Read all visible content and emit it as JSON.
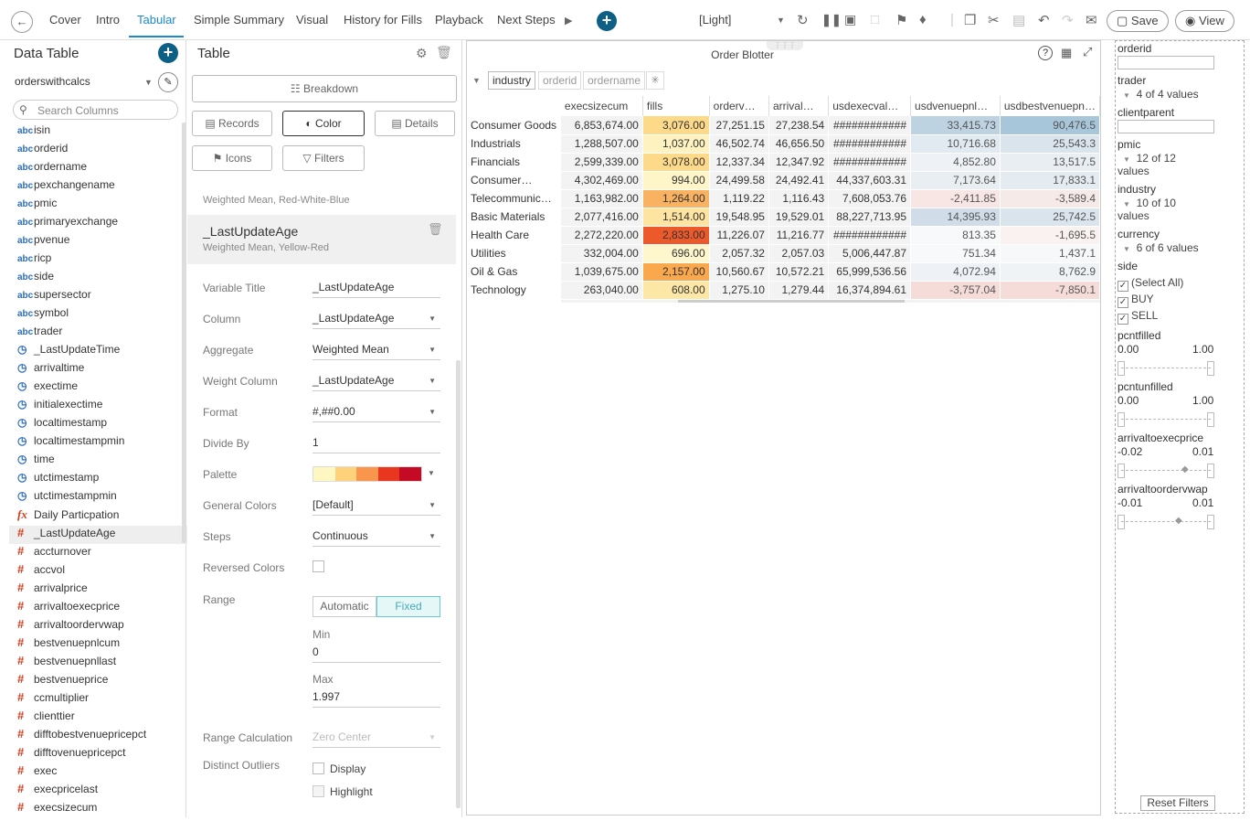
{
  "nav": {
    "tabs": [
      "Cover",
      "Intro",
      "Tabular",
      "Simple Summary",
      "Visual",
      "History for Fills",
      "Playback",
      "Next Steps"
    ],
    "theme": "[Light]",
    "save_label": "Save",
    "view_label": "View"
  },
  "data_table": {
    "title": "Data Table",
    "source": "orderswithcalcs",
    "search_placeholder": "Search Columns",
    "fields": [
      {
        "type": "abc",
        "name": "isin"
      },
      {
        "type": "abc",
        "name": "orderid"
      },
      {
        "type": "abc",
        "name": "ordername"
      },
      {
        "type": "abc",
        "name": "pexchangename"
      },
      {
        "type": "abc",
        "name": "pmic"
      },
      {
        "type": "abc",
        "name": "primaryexchange"
      },
      {
        "type": "abc",
        "name": "pvenue"
      },
      {
        "type": "abc",
        "name": "ricp"
      },
      {
        "type": "abc",
        "name": "side"
      },
      {
        "type": "abc",
        "name": "supersector"
      },
      {
        "type": "abc",
        "name": "symbol"
      },
      {
        "type": "abc",
        "name": "trader"
      },
      {
        "type": "time",
        "name": "_LastUpdateTime"
      },
      {
        "type": "time",
        "name": "arrivaltime"
      },
      {
        "type": "time",
        "name": "exectime"
      },
      {
        "type": "time",
        "name": "initialexectime"
      },
      {
        "type": "time",
        "name": "localtimestamp"
      },
      {
        "type": "time",
        "name": "localtimestampmin"
      },
      {
        "type": "time",
        "name": "time"
      },
      {
        "type": "time",
        "name": "utctimestamp"
      },
      {
        "type": "time",
        "name": "utctimestampmin"
      },
      {
        "type": "fx",
        "name": "Daily Particpation"
      },
      {
        "type": "num",
        "name": "_LastUpdateAge"
      },
      {
        "type": "num",
        "name": "accturnover"
      },
      {
        "type": "num",
        "name": "accvol"
      },
      {
        "type": "num",
        "name": "arrivalprice"
      },
      {
        "type": "num",
        "name": "arrivaltoexecprice"
      },
      {
        "type": "num",
        "name": "arrivaltoordervwap"
      },
      {
        "type": "num",
        "name": "bestvenuepnlcum"
      },
      {
        "type": "num",
        "name": "bestvenuepnllast"
      },
      {
        "type": "num",
        "name": "bestvenueprice"
      },
      {
        "type": "num",
        "name": "ccmultiplier"
      },
      {
        "type": "num",
        "name": "clienttier"
      },
      {
        "type": "num",
        "name": "difftobestvenuepricepct"
      },
      {
        "type": "num",
        "name": "difftovenuepricepct"
      },
      {
        "type": "num",
        "name": "exec"
      },
      {
        "type": "num",
        "name": "execpricelast"
      },
      {
        "type": "num",
        "name": "execsizecum"
      }
    ]
  },
  "table_settings": {
    "title": "Table",
    "breakdown": "Breakdown",
    "buttons": [
      "Records",
      "Color",
      "Details",
      "Icons",
      "Filters"
    ],
    "prev_sub": "Weighted Mean, Red-White-Blue",
    "item_title": "_LastUpdateAge",
    "item_sub": "Weighted Mean, Yellow-Red",
    "props": {
      "variable_title": {
        "label": "Variable Title",
        "value": "_LastUpdateAge"
      },
      "column": {
        "label": "Column",
        "value": "_LastUpdateAge"
      },
      "aggregate": {
        "label": "Aggregate",
        "value": "Weighted Mean"
      },
      "weight_column": {
        "label": "Weight Column",
        "value": "_LastUpdateAge"
      },
      "format": {
        "label": "Format",
        "value": "#,##0.00"
      },
      "divide_by": {
        "label": "Divide By",
        "value": "1"
      },
      "palette": {
        "label": "Palette"
      },
      "general_colors": {
        "label": "General Colors",
        "value": "[Default]"
      },
      "steps": {
        "label": "Steps",
        "value": "Continuous"
      },
      "reversed_colors": {
        "label": "Reversed Colors"
      },
      "range": {
        "label": "Range",
        "automatic": "Automatic",
        "fixed": "Fixed"
      },
      "min": {
        "label": "Min",
        "value": "0"
      },
      "max": {
        "label": "Max",
        "value": "1.997"
      },
      "range_calculation": {
        "label": "Range Calculation",
        "value": "Zero Center"
      },
      "distinct_outliers": {
        "label": "Distinct Outliers",
        "display": "Display",
        "highlight": "Highlight"
      }
    },
    "palette_colors": [
      "#fff7c2",
      "#fdd27a",
      "#f9964e",
      "#e8361f",
      "#c40a25"
    ]
  },
  "blotter": {
    "title": "Order Blotter",
    "breakdown_chips": [
      "industry",
      "orderid",
      "ordername"
    ],
    "columns": [
      "execsizecum",
      "fills",
      "orderv…",
      "arrival…",
      "usdexecval…",
      "usdvenuepnl…",
      "usdbestvenuepn…"
    ],
    "rows": [
      {
        "name": "Consumer Goods",
        "vals": [
          "6,853,674.00",
          "3,076.00",
          "27,251.15",
          "27,238.54",
          "############",
          "33,415.73",
          "90,476.5"
        ],
        "fc": "#fdd98a",
        "c5": "#bed3e1",
        "c6": "#a8c6da"
      },
      {
        "name": "Industrials",
        "vals": [
          "1,288,507.00",
          "1,037.00",
          "46,502.74",
          "46,656.50",
          "############",
          "10,716.68",
          "25,543.3"
        ],
        "fc": "#fef3c0",
        "c5": "#e2eaf1",
        "c6": "#dae4ed"
      },
      {
        "name": "Financials",
        "vals": [
          "2,599,339.00",
          "3,078.00",
          "12,337.34",
          "12,347.92",
          "############",
          "4,852.80",
          "13,517.5"
        ],
        "fc": "#fdd98a",
        "c5": "#eef2f6",
        "c6": "#e9eef3"
      },
      {
        "name": "Consumer…",
        "vals": [
          "4,302,469.00",
          "994.00",
          "24,499.58",
          "24,492.41",
          "44,337,603.31",
          "7,173.64",
          "17,833.1"
        ],
        "fc": "#fef5c8",
        "c5": "#e9eef3",
        "c6": "#e4ebf1"
      },
      {
        "name": "Telecommunic…",
        "vals": [
          "1,163,982.00",
          "1,264.00",
          "1,119.22",
          "1,116.43",
          "7,608,053.76",
          "-2,411.85",
          "-3,589.4"
        ],
        "fc": "#f8b261",
        "c5": "#f8e6e4",
        "c6": "#f6eae8"
      },
      {
        "name": "Basic Materials",
        "vals": [
          "2,077,416.00",
          "1,514.00",
          "19,548.95",
          "19,529.01",
          "88,227,713.95",
          "14,395.93",
          "25,742.5"
        ],
        "fc": "#fde4a0",
        "c5": "#d0dde8",
        "c6": "#dae4ed"
      },
      {
        "name": "Health Care",
        "vals": [
          "2,272,220.00",
          "2,833.00",
          "11,226.07",
          "11,216.77",
          "############",
          "813.35",
          "-1,695.5"
        ],
        "fc": "#ec5a2c",
        "c5": "#f8f9fb",
        "c6": "#faf2f1"
      },
      {
        "name": "Utilities",
        "vals": [
          "332,004.00",
          "696.00",
          "2,057.32",
          "2,057.03",
          "5,006,447.87",
          "751.34",
          "1,437.1"
        ],
        "fc": "#fef6cc",
        "c5": "#f8f9fb",
        "c6": "#f7f8fa"
      },
      {
        "name": "Oil & Gas",
        "vals": [
          "1,039,675.00",
          "2,157.00",
          "10,560.67",
          "10,572.21",
          "65,999,536.56",
          "4,072.94",
          "8,762.9"
        ],
        "fc": "#f9a84e",
        "c5": "#eef2f6",
        "c6": "#f0f3f6"
      },
      {
        "name": "Technology",
        "vals": [
          "263,040.00",
          "608.00",
          "1,275.10",
          "1,279.44",
          "16,374,894.61",
          "-3,757.04",
          "-7,850.1"
        ],
        "fc": "#fde7a6",
        "c5": "#f6dcd9",
        "c6": "#f6dcd9"
      }
    ]
  },
  "filters": {
    "orderid": "orderid",
    "trader": "trader",
    "trader_sub": "4 of 4 values",
    "clientparent": "clientparent",
    "pmic": "pmic",
    "pmic_sub": "12 of 12",
    "pmic_sub2": "values",
    "industry": "industry",
    "industry_sub": "10 of 10",
    "industry_sub2": "values",
    "currency": "currency",
    "currency_sub": "6 of 6 values",
    "side": "side",
    "side_opts": [
      "(Select All)",
      "BUY",
      "SELL"
    ],
    "pcntfilled": {
      "label": "pcntfilled",
      "min": "0.00",
      "max": "1.00"
    },
    "pcntunfilled": {
      "label": "pcntunfilled",
      "min": "0.00",
      "max": "1.00"
    },
    "arrivaltoexecprice": {
      "label": "arrivaltoexecprice",
      "min": "-0.02",
      "max": "0.01"
    },
    "arrivaltoordervwap": {
      "label": "arrivaltoordervwap",
      "min": "-0.01",
      "max": "0.01"
    },
    "reset": "Reset Filters"
  }
}
